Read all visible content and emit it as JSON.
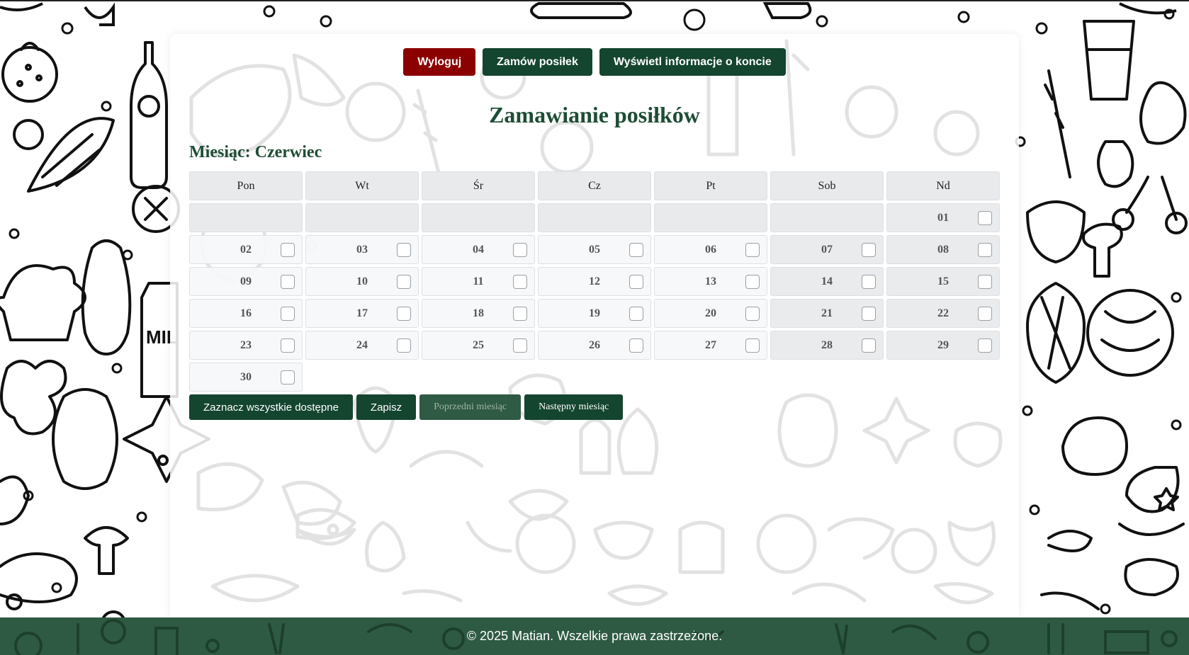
{
  "nav": {
    "logout_label": "Wyloguj",
    "order_label": "Zamów posiłek",
    "account_label": "Wyświetl informacje o koncie"
  },
  "page": {
    "title": "Zamawianie posiłków",
    "month_heading": "Miesiąc: Czerwiec"
  },
  "calendar": {
    "weekdays": [
      "Pon",
      "Wt",
      "Śr",
      "Cz",
      "Pt",
      "Sob",
      "Nd"
    ],
    "weeks": [
      [
        null,
        null,
        null,
        null,
        null,
        null,
        "01"
      ],
      [
        "02",
        "03",
        "04",
        "05",
        "06",
        "07",
        "08"
      ],
      [
        "09",
        "10",
        "11",
        "12",
        "13",
        "14",
        "15"
      ],
      [
        "16",
        "17",
        "18",
        "19",
        "20",
        "21",
        "22"
      ],
      [
        "23",
        "24",
        "25",
        "26",
        "27",
        "28",
        "29"
      ],
      [
        "30"
      ]
    ]
  },
  "actions": {
    "select_all_label": "Zaznacz wszystkie dostępne",
    "save_label": "Zapisz",
    "prev_month_label": "Poprzedni miesiąc",
    "next_month_label": "Następny miesiąc"
  },
  "footer": {
    "text": "© 2025 Matian. Wszelkie prawa zastrzeżone."
  },
  "colors": {
    "brand_green": "#14452f",
    "title_green": "#1e4d35",
    "logout_red": "#8b0000",
    "footer_green": "#2e5a43"
  },
  "icons": [
    "checkbox-icon"
  ]
}
